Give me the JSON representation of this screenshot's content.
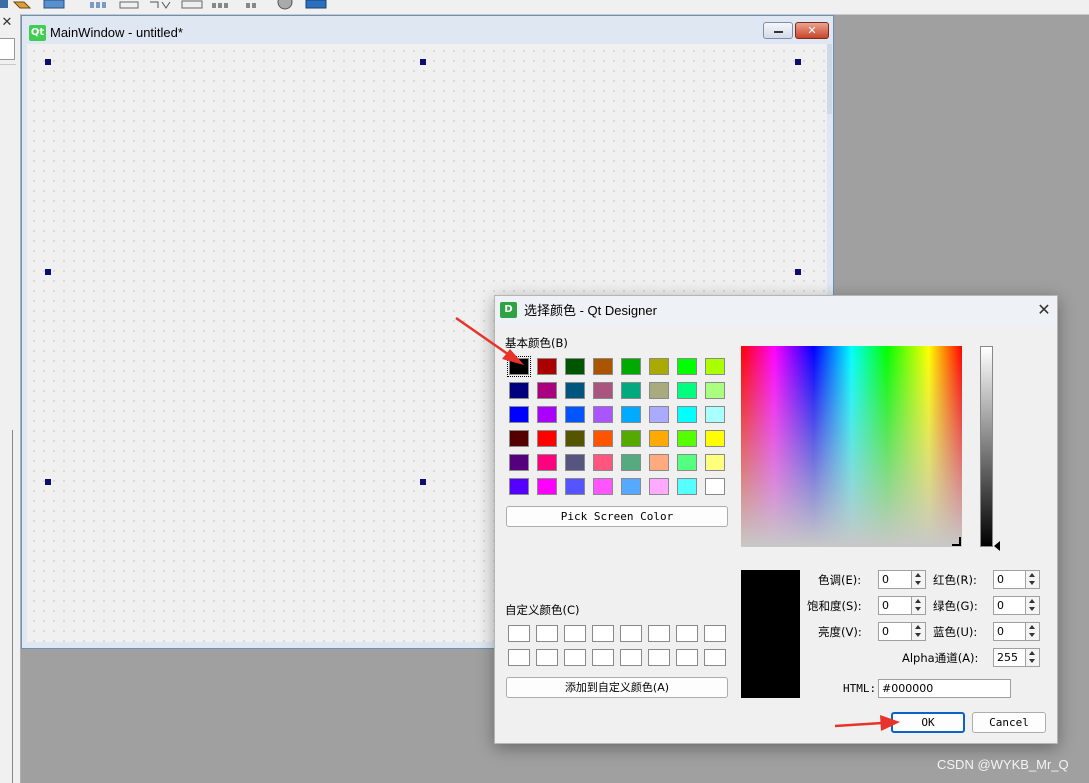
{
  "toolbar": {
    "icons": [
      "form-icon",
      "edit-widgets-icon",
      "layout-horizontal-icon",
      "layout-vertical-icon",
      "layout-grid-icon",
      "layout-form-icon",
      "break-layout-icon",
      "adjust-size-icon",
      "preview-icon"
    ]
  },
  "left_panel": {
    "close_glyph": "✕"
  },
  "main_window": {
    "title": "MainWindow - untitled*",
    "logo_text": "Qt",
    "close_glyph": "✕"
  },
  "dialog": {
    "title": "选择颜色 - Qt Designer",
    "logo_text": "D",
    "close_glyph": "✕",
    "basic_colors_label": "基本颜色(B)",
    "basic_colors": [
      "#000000",
      "#aa0000",
      "#005500",
      "#aa5500",
      "#00aa00",
      "#aaaa00",
      "#00ff00",
      "#aaff00",
      "#00007f",
      "#aa007f",
      "#00557f",
      "#aa557f",
      "#00aa7f",
      "#aaaa7f",
      "#00ff7f",
      "#aaff7f",
      "#0000ff",
      "#aa00ff",
      "#0055ff",
      "#aa55ff",
      "#00aaff",
      "#aaaaff",
      "#00ffff",
      "#aaffff",
      "#550000",
      "#ff0000",
      "#555500",
      "#ff5500",
      "#55aa00",
      "#ffaa00",
      "#55ff00",
      "#ffff00",
      "#55007f",
      "#ff007f",
      "#55557f",
      "#ff557f",
      "#55aa7f",
      "#ffaa7f",
      "#55ff7f",
      "#ffff7f",
      "#5500ff",
      "#ff00ff",
      "#5555ff",
      "#ff55ff",
      "#55aaff",
      "#ffaaff",
      "#55ffff",
      "#ffffff"
    ],
    "selected_basic_index": 0,
    "pick_screen_label": "Pick Screen Color",
    "custom_colors_label": "自定义颜色(C)",
    "custom_colors_count": 16,
    "add_custom_label": "添加到自定义颜色(A)",
    "fields": {
      "hue_label": "色调(E):",
      "hue_value": "0",
      "sat_label": "饱和度(S):",
      "sat_value": "0",
      "val_label": "亮度(V):",
      "val_value": "0",
      "red_label": "红色(R):",
      "red_value": "0",
      "green_label": "绿色(G):",
      "green_value": "0",
      "blue_label": "蓝色(U):",
      "blue_value": "0",
      "alpha_label": "Alpha通道(A):",
      "alpha_value": "255",
      "html_label": "HTML:",
      "html_value": "#000000"
    },
    "current_color": "#000000",
    "ok_label": "OK",
    "cancel_label": "Cancel"
  },
  "watermark": "CSDN @WYKB_Mr_Q"
}
